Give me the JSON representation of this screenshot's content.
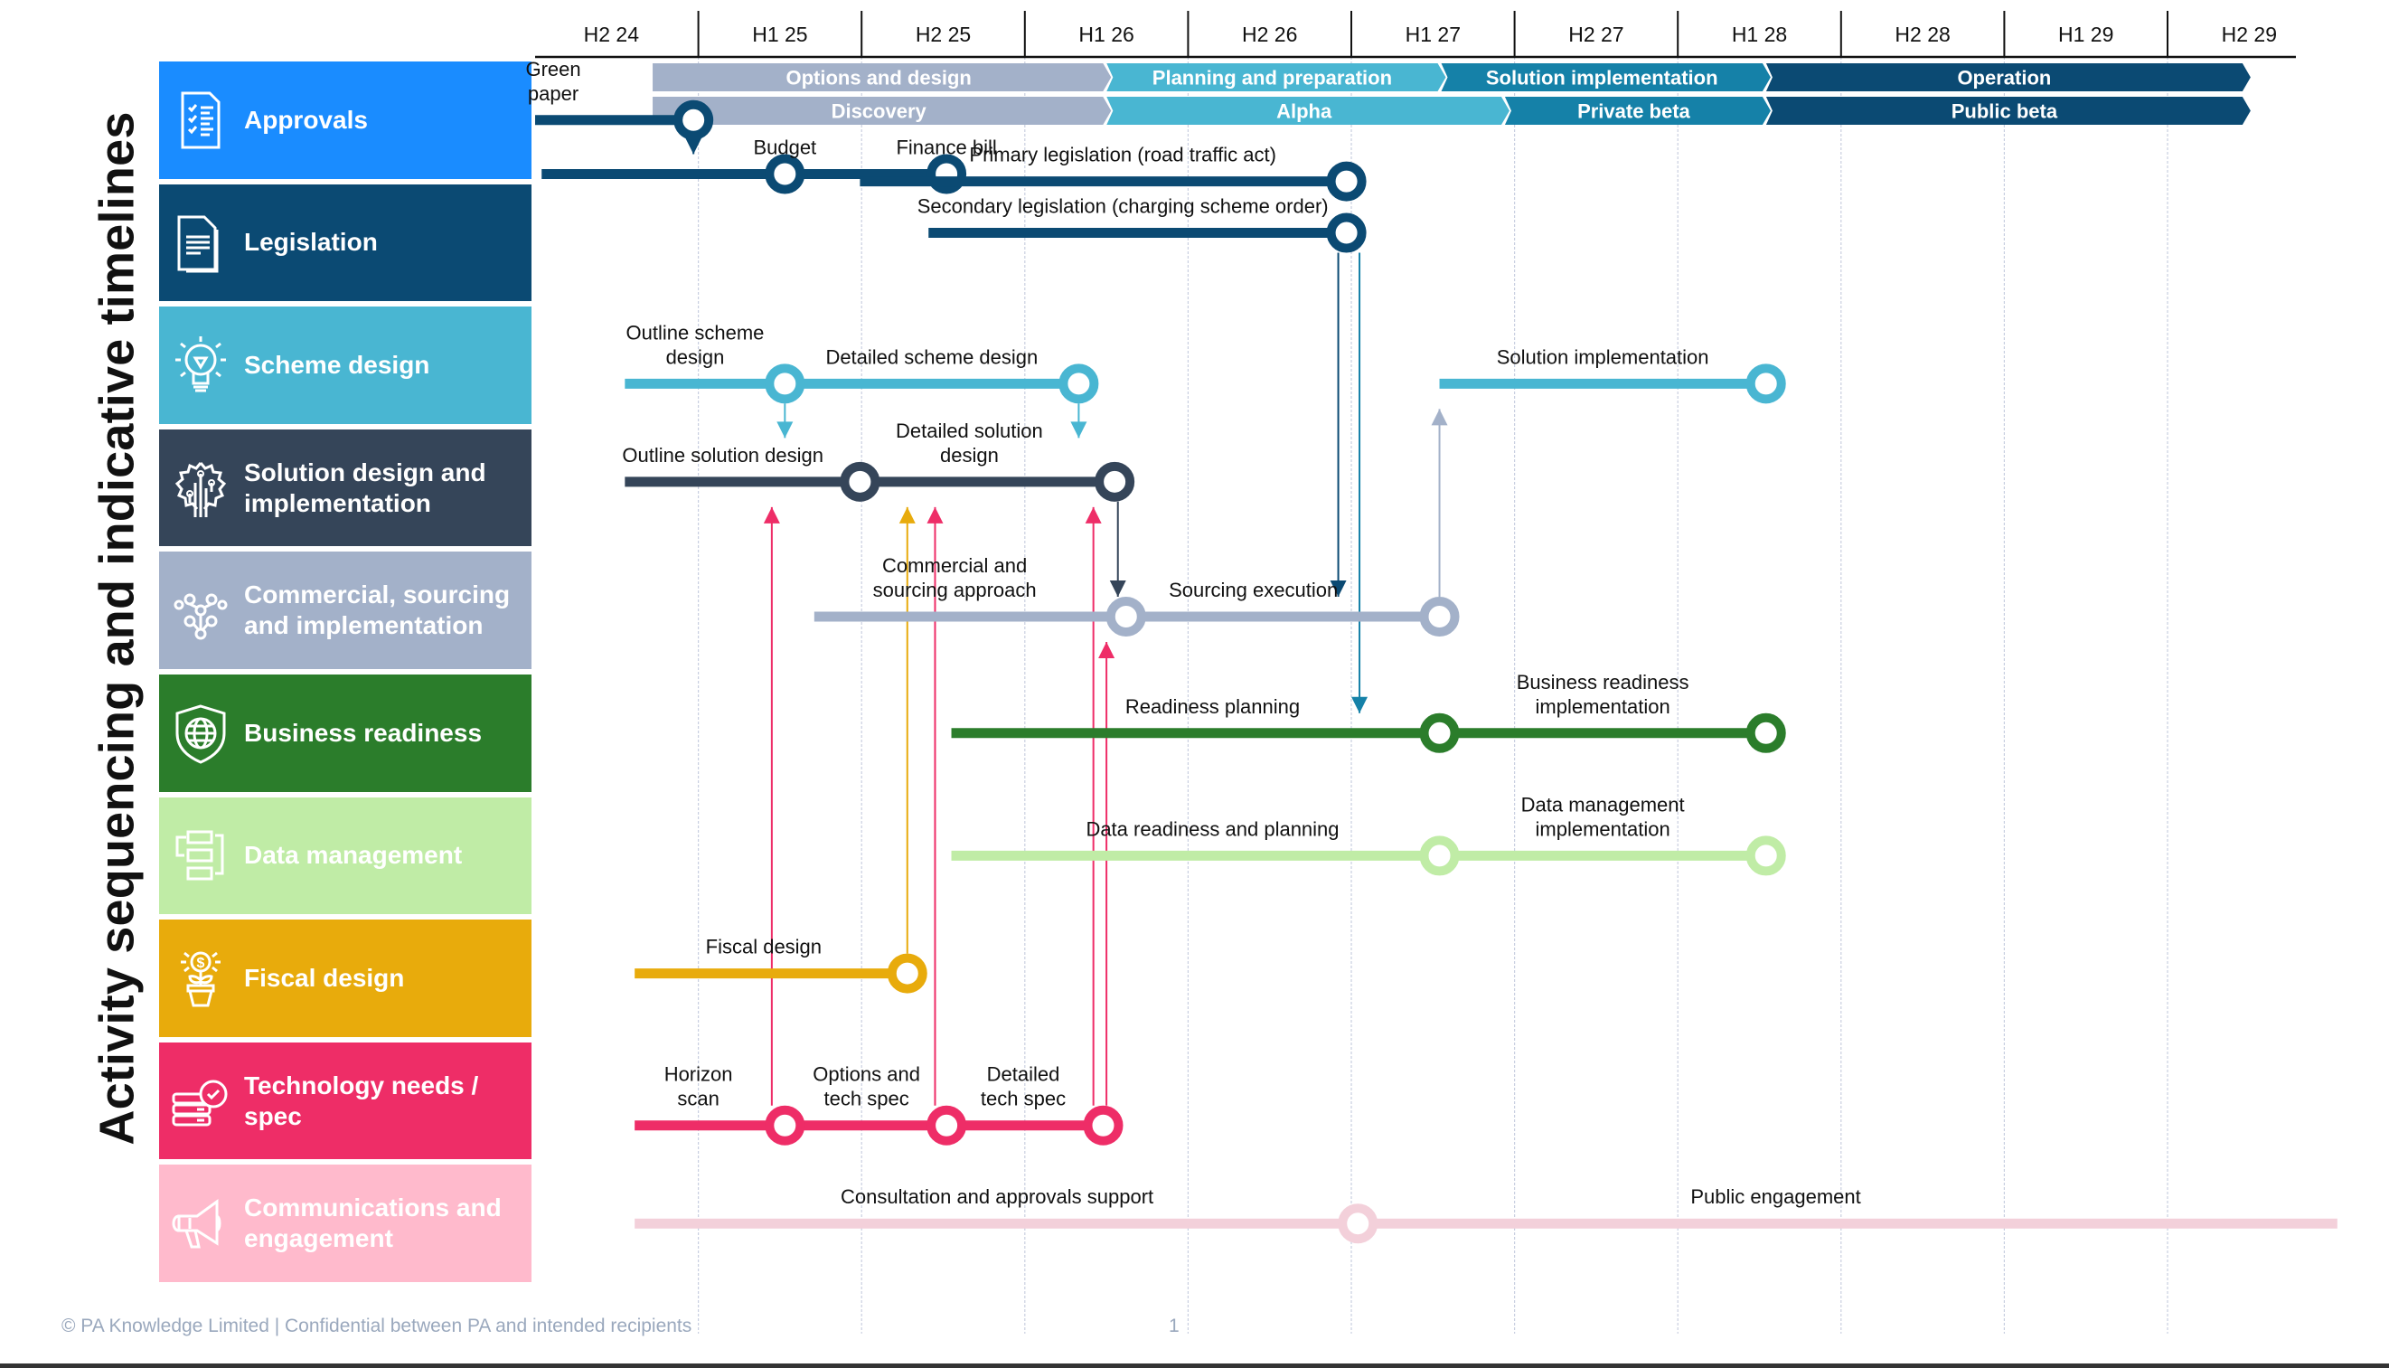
{
  "title": "Activity sequencing and indicative timelines",
  "periods": [
    "H2 24",
    "H1 25",
    "H2 25",
    "H1 26",
    "H2 26",
    "H1 27",
    "H2 27",
    "H1 28",
    "H2 28",
    "H1 29",
    "H2 29"
  ],
  "phases_top": [
    {
      "label": "Options and design",
      "start": 0.72,
      "end": 3.49,
      "color": "#a3b1c9"
    },
    {
      "label": "Planning and preparation",
      "start": 3.49,
      "end": 5.54,
      "color": "#49b6d2"
    },
    {
      "label": "Solution implementation",
      "start": 5.54,
      "end": 7.53,
      "color": "#1581a8"
    },
    {
      "label": "Operation",
      "start": 7.53,
      "end": 10.47,
      "color": "#0b4a73"
    }
  ],
  "phases_bottom": [
    {
      "label": "Discovery",
      "start": 0.72,
      "end": 3.49,
      "color": "#a3b1c9"
    },
    {
      "label": "Alpha",
      "start": 3.49,
      "end": 5.93,
      "color": "#49b6d2"
    },
    {
      "label": "Private beta",
      "start": 5.93,
      "end": 7.53,
      "color": "#1581a8"
    },
    {
      "label": "Public beta",
      "start": 7.53,
      "end": 10.47,
      "color": "#0b4a73"
    }
  ],
  "lanes": [
    {
      "label": "Approvals",
      "icon": "checklist-icon",
      "color": "#1a8cff"
    },
    {
      "label": "Legislation",
      "icon": "document-icon",
      "color": "#0b4a73"
    },
    {
      "label": "Scheme design",
      "icon": "lightbulb-icon",
      "color": "#49b6d2"
    },
    {
      "label": "Solution design and implementation",
      "icon": "gear-circuit-icon",
      "color": "#354559"
    },
    {
      "label": "Commercial, sourcing and implementation",
      "icon": "network-icon",
      "color": "#a3b1c9"
    },
    {
      "label": "Business readiness",
      "icon": "shield-globe-icon",
      "color": "#2b7d2b"
    },
    {
      "label": "Data management",
      "icon": "data-flow-icon",
      "color": "#c0eca6"
    },
    {
      "label": "Fiscal design",
      "icon": "money-plant-icon",
      "color": "#e8ab0c"
    },
    {
      "label": "Technology needs / spec",
      "icon": "server-check-icon",
      "color": "#ee2d67"
    },
    {
      "label": "Communications and engagement",
      "icon": "megaphone-icon",
      "color": "#ffbacc"
    }
  ],
  "tracks": [
    {
      "lane": 0,
      "y_offset": 0.0,
      "color": "#0b4a73",
      "start": 0.0,
      "milestones": [
        0.97
      ],
      "labels": [
        {
          "text": "Green\npaper",
          "x": 0.1,
          "dy": -1
        }
      ]
    },
    {
      "lane": 0,
      "y_offset": 0.44,
      "color": "#0b4a73",
      "start": 0.04,
      "milestones": [
        1.53,
        2.52
      ],
      "labels": [
        {
          "text": "Budget",
          "x": 1.53,
          "dy": -1
        },
        {
          "text": "Finance bill",
          "x": 2.52,
          "dy": -1
        }
      ]
    },
    {
      "lane": 1,
      "y_offset": -0.5,
      "color": "#0b4a73",
      "start": 1.99,
      "milestones": [
        4.97
      ],
      "labels": [
        {
          "text": "Primary legislation (road traffic act)",
          "x": 3.6,
          "dy": -1
        }
      ]
    },
    {
      "lane": 1,
      "y_offset": -0.08,
      "color": "#0b4a73",
      "start": 2.41,
      "milestones": [
        4.97
      ],
      "labels": [
        {
          "text": "Secondary legislation (charging scheme order)",
          "x": 3.6,
          "dy": -1
        }
      ]
    },
    {
      "lane": 2,
      "y_offset": 0.15,
      "color": "#49b6d2",
      "start": 0.55,
      "milestones": [
        1.53,
        3.33
      ],
      "labels": [
        {
          "text": "Outline scheme\ndesign",
          "x": 0.98,
          "dy": -1
        },
        {
          "text": "Detailed scheme design",
          "x": 2.43,
          "dy": -1
        }
      ]
    },
    {
      "lane": 2,
      "y_offset": 0.15,
      "color": "#49b6d2",
      "start": 5.54,
      "milestones": [
        7.54
      ],
      "labels": [
        {
          "text": "Solution implementation",
          "x": 6.54,
          "dy": -1
        }
      ]
    },
    {
      "lane": 3,
      "y_offset": -0.05,
      "color": "#354559",
      "start": 0.55,
      "milestones": [
        1.99,
        3.55
      ],
      "labels": [
        {
          "text": "Outline solution design",
          "x": 1.15,
          "dy": -1
        },
        {
          "text": "Detailed solution\ndesign",
          "x": 2.66,
          "dy": -1
        }
      ]
    },
    {
      "lane": 4,
      "y_offset": 0.05,
      "color": "#a3b1c9",
      "start": 1.71,
      "milestones": [
        3.62,
        5.54
      ],
      "labels": [
        {
          "text": "Commercial and\nsourcing approach",
          "x": 2.57,
          "dy": -1
        },
        {
          "text": "Sourcing execution",
          "x": 4.4,
          "dy": -1
        }
      ]
    },
    {
      "lane": 5,
      "y_offset": 0.0,
      "color": "#2b7d2b",
      "start": 2.55,
      "milestones": [
        5.54,
        7.54
      ],
      "labels": [
        {
          "text": "Readiness planning",
          "x": 4.15,
          "dy": -1
        },
        {
          "text": "Business readiness\nimplementation",
          "x": 6.54,
          "dy": -1
        }
      ]
    },
    {
      "lane": 6,
      "y_offset": 0.0,
      "color": "#c0eca6",
      "start": 2.55,
      "milestones": [
        5.54,
        7.54
      ],
      "labels": [
        {
          "text": "Data readiness and planning",
          "x": 4.15,
          "dy": -1
        },
        {
          "text": "Data management\nimplementation",
          "x": 6.54,
          "dy": -1
        }
      ]
    },
    {
      "lane": 7,
      "y_offset": -0.04,
      "color": "#e8ab0c",
      "start": 0.61,
      "milestones": [
        2.28
      ],
      "labels": [
        {
          "text": "Fiscal design",
          "x": 1.4,
          "dy": -1
        }
      ]
    },
    {
      "lane": 8,
      "y_offset": 0.2,
      "color": "#ee2d67",
      "start": 0.61,
      "milestones": [
        1.53,
        2.52,
        3.48
      ],
      "labels": [
        {
          "text": "Horizon\nscan",
          "x": 1.0,
          "dy": -1
        },
        {
          "text": "Options and\ntech spec",
          "x": 2.03,
          "dy": -1
        },
        {
          "text": "Detailed\ntech spec",
          "x": 2.99,
          "dy": -1
        }
      ]
    },
    {
      "lane": 9,
      "y_offset": 0.0,
      "color": "#f3d0da",
      "start": 0.61,
      "end": 11.04,
      "milestones": [
        5.04
      ],
      "labels": [
        {
          "text": "Consultation and approvals support",
          "x": 2.83,
          "dy": -1
        },
        {
          "text": "Public engagement",
          "x": 7.6,
          "dy": -1
        }
      ]
    }
  ],
  "dependencies": [
    {
      "x": 0.97,
      "from_track": 0,
      "to_track": 1,
      "color": "#0b4a73"
    },
    {
      "x": 1.53,
      "from_track": 4,
      "to_track": 6,
      "color": "#49b6d2",
      "stub": true
    },
    {
      "x": 3.33,
      "from_track": 4,
      "to_track": 6,
      "color": "#49b6d2",
      "stub": true
    },
    {
      "x": 4.92,
      "from_track": 3,
      "to_track": 7,
      "color": "#0b4a73"
    },
    {
      "x": 5.05,
      "from_track": 3,
      "to_track": 8,
      "color": "#1581a8"
    },
    {
      "x": 5.54,
      "from_track": 7,
      "to_track": 5,
      "color": "#a3b1c9"
    },
    {
      "x": 3.57,
      "from_track": 6,
      "to_track": 7,
      "color": "#354559"
    },
    {
      "x": 1.45,
      "from_track": 11,
      "to_track": 6,
      "color": "#ee2d67"
    },
    {
      "x": 2.28,
      "from_track": 10,
      "to_track": 6,
      "color": "#e8ab0c"
    },
    {
      "x": 2.45,
      "from_track": 11,
      "to_track": 6,
      "color": "#ee2d67"
    },
    {
      "x": 3.42,
      "from_track": 11,
      "to_track": 6,
      "color": "#ee2d67"
    },
    {
      "x": 3.5,
      "from_track": 11,
      "to_track": 7,
      "color": "#ee2d67"
    }
  ],
  "footer": {
    "copyright": "© PA Knowledge Limited  | Confidential between PA and intended recipients",
    "page": "1"
  }
}
